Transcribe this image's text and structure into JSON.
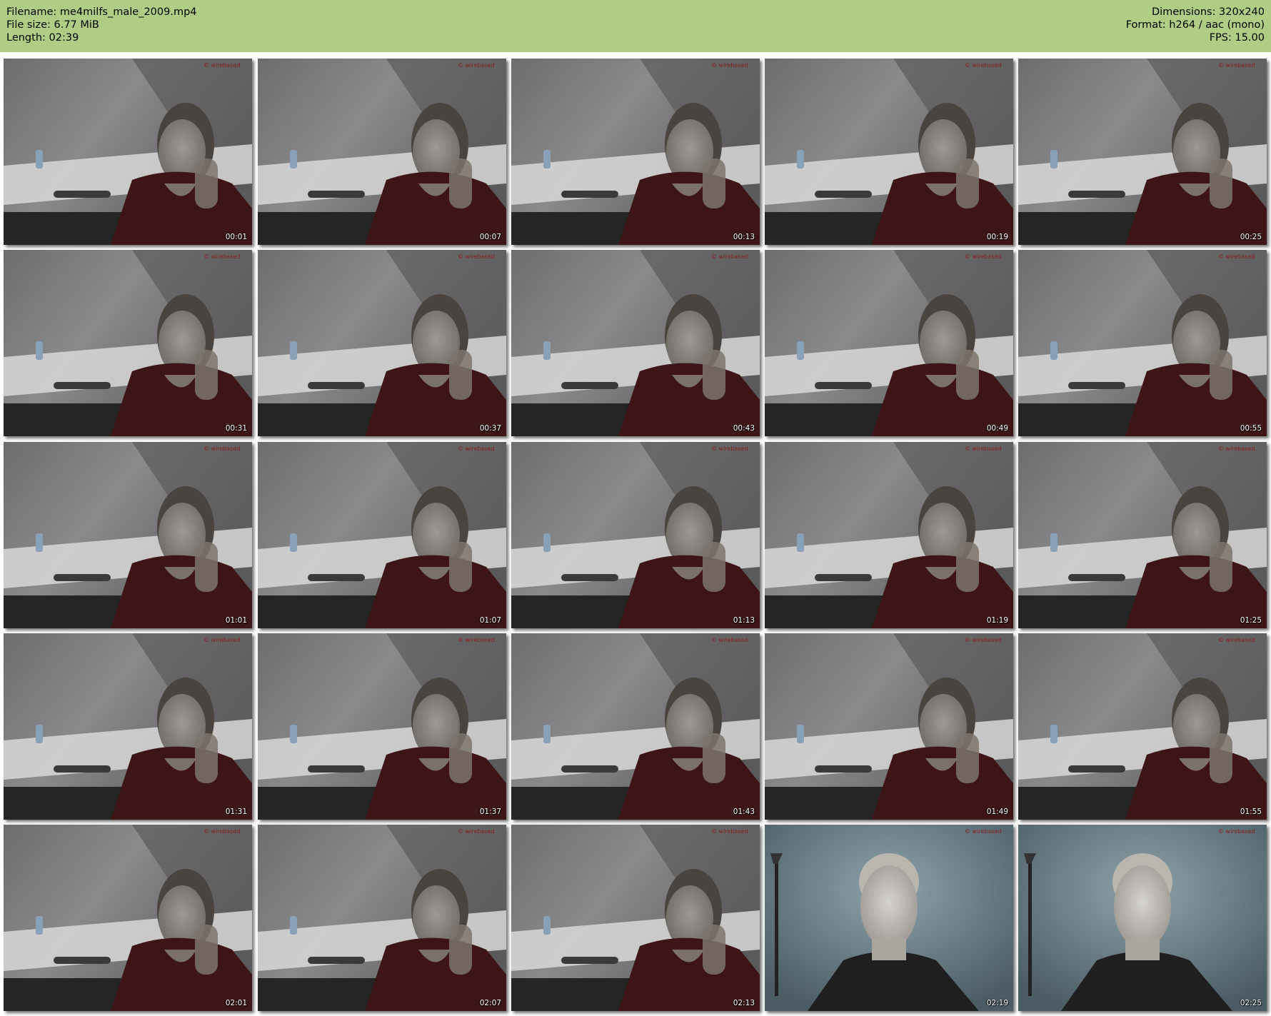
{
  "header": {
    "filename_line": "Filename: me4milfs_male_2009.mp4",
    "filesize_line": "File size: 6.77 MiB",
    "length_line": "Length: 02:39",
    "dimensions_line": "Dimensions: 320x240",
    "format_line": "Format: h264 / aac (mono)",
    "fps_line": "FPS: 15.00",
    "background_color": "#b0cd85"
  },
  "frames": [
    {
      "time": "00:01",
      "scene": "dim"
    },
    {
      "time": "00:07",
      "scene": "dim"
    },
    {
      "time": "00:13",
      "scene": "dim"
    },
    {
      "time": "00:19",
      "scene": "dim"
    },
    {
      "time": "00:25",
      "scene": "dim"
    },
    {
      "time": "00:31",
      "scene": "dim"
    },
    {
      "time": "00:37",
      "scene": "dim"
    },
    {
      "time": "00:43",
      "scene": "dim"
    },
    {
      "time": "00:49",
      "scene": "dim"
    },
    {
      "time": "00:55",
      "scene": "dim"
    },
    {
      "time": "01:01",
      "scene": "dim"
    },
    {
      "time": "01:07",
      "scene": "dim"
    },
    {
      "time": "01:13",
      "scene": "dim"
    },
    {
      "time": "01:19",
      "scene": "dim"
    },
    {
      "time": "01:25",
      "scene": "dim"
    },
    {
      "time": "01:31",
      "scene": "dim"
    },
    {
      "time": "01:37",
      "scene": "dim"
    },
    {
      "time": "01:43",
      "scene": "dim"
    },
    {
      "time": "01:49",
      "scene": "dim"
    },
    {
      "time": "01:55",
      "scene": "dim"
    },
    {
      "time": "02:01",
      "scene": "dim"
    },
    {
      "time": "02:07",
      "scene": "dim"
    },
    {
      "time": "02:13",
      "scene": "dim"
    },
    {
      "time": "02:19",
      "scene": "blue"
    },
    {
      "time": "02:25",
      "scene": "blue"
    }
  ]
}
